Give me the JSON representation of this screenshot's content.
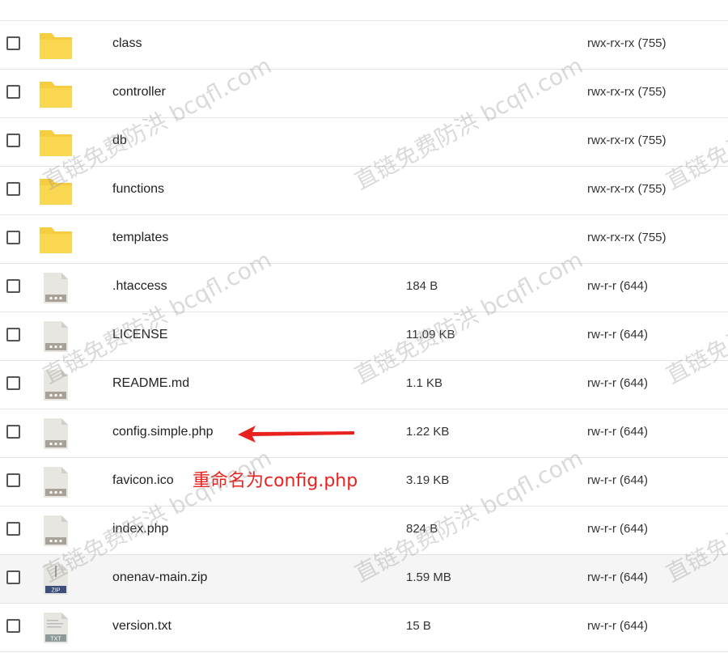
{
  "files": [
    {
      "name": "class",
      "size": "",
      "perm": "rwx-rx-rx (755)",
      "type": "folder"
    },
    {
      "name": "controller",
      "size": "",
      "perm": "rwx-rx-rx (755)",
      "type": "folder"
    },
    {
      "name": "db",
      "size": "",
      "perm": "rwx-rx-rx (755)",
      "type": "folder"
    },
    {
      "name": "functions",
      "size": "",
      "perm": "rwx-rx-rx (755)",
      "type": "folder"
    },
    {
      "name": "templates",
      "size": "",
      "perm": "rwx-rx-rx (755)",
      "type": "folder"
    },
    {
      "name": ".htaccess",
      "size": "184 B",
      "perm": "rw-r-r (644)",
      "type": "file"
    },
    {
      "name": "LICENSE",
      "size": "11.09 KB",
      "perm": "rw-r-r (644)",
      "type": "file"
    },
    {
      "name": "README.md",
      "size": "1.1 KB",
      "perm": "rw-r-r (644)",
      "type": "file"
    },
    {
      "name": "config.simple.php",
      "size": "1.22 KB",
      "perm": "rw-r-r (644)",
      "type": "file"
    },
    {
      "name": "favicon.ico",
      "size": "3.19 KB",
      "perm": "rw-r-r (644)",
      "type": "file"
    },
    {
      "name": "index.php",
      "size": "824 B",
      "perm": "rw-r-r (644)",
      "type": "file"
    },
    {
      "name": "onenav-main.zip",
      "size": "1.59 MB",
      "perm": "rw-r-r (644)",
      "type": "zip",
      "badge": "ZIP"
    },
    {
      "name": "version.txt",
      "size": "15 B",
      "perm": "rw-r-r (644)",
      "type": "txt",
      "badge": "TXT"
    }
  ],
  "annotation": {
    "text": "重命名为config.php",
    "color": "#e8231f"
  },
  "watermark": {
    "text": "直链免费防洪 bcqfl.com"
  }
}
